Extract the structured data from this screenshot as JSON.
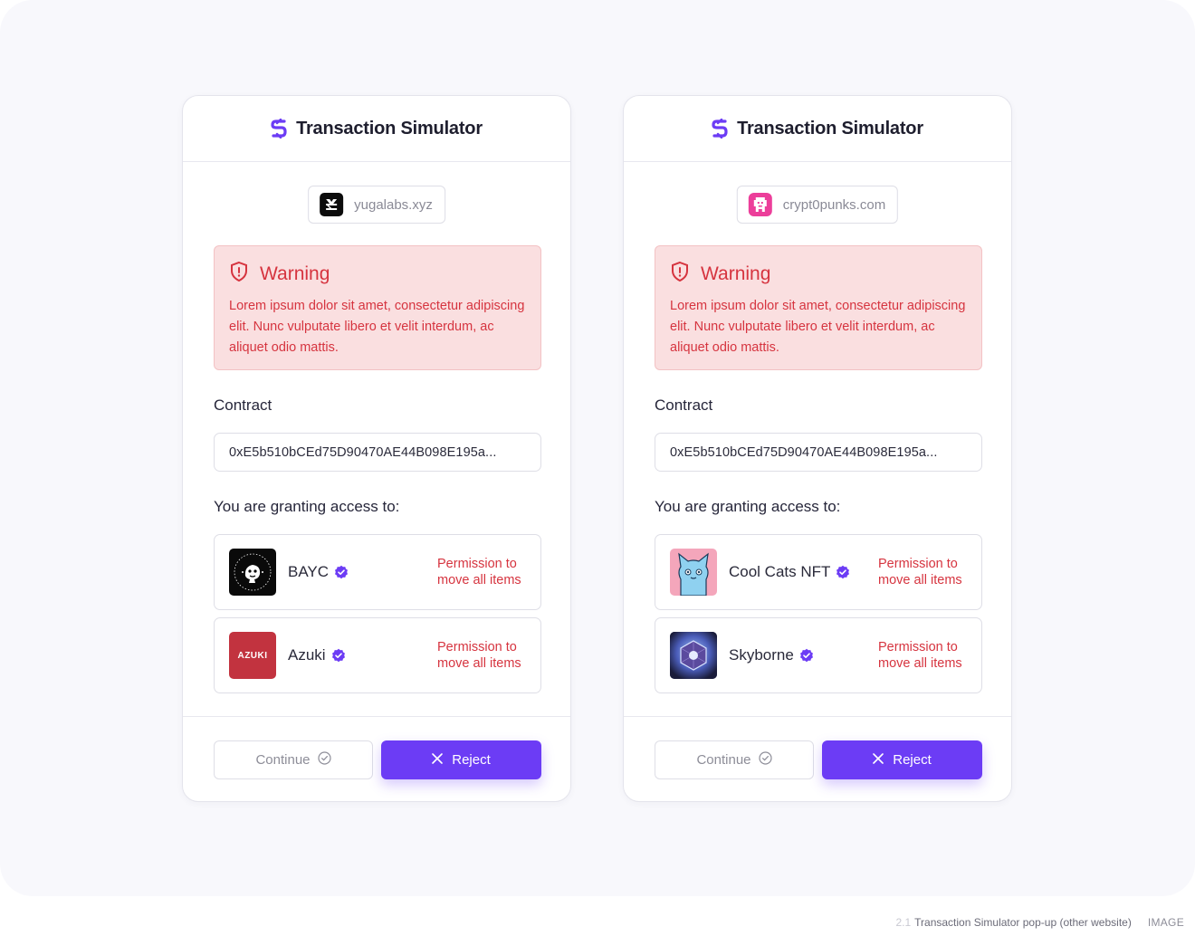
{
  "caption": {
    "index": "2.1",
    "text": "Transaction Simulator pop-up (other website)",
    "kind": "IMAGE"
  },
  "colors": {
    "accent": "#6c3cf5",
    "danger": "#d6343f",
    "warning_bg": "#fadfe0"
  },
  "cards": [
    {
      "title": "Transaction Simulator",
      "site": {
        "name": "yugalabs.xyz",
        "icon": "yuga-labs-logo"
      },
      "warning": {
        "title": "Warning",
        "body": "Lorem ipsum dolor sit amet, consectetur adipiscing elit. Nunc vulputate libero et velit interdum, ac aliquet odio mattis."
      },
      "contract_label": "Contract",
      "contract_address": "0xE5b510bCEd75D90470AE44B098E195a...",
      "access_label": "You are granting access to:",
      "grants": [
        {
          "name": "BAYC",
          "thumb": "bayc-logo",
          "verified": true,
          "permission": "Permission to move all items"
        },
        {
          "name": "Azuki",
          "thumb": "azuki-logo",
          "thumb_text": "AZUKI",
          "verified": true,
          "permission": "Permission to move all items"
        }
      ],
      "continue_label": "Continue",
      "reject_label": "Reject"
    },
    {
      "title": "Transaction Simulator",
      "site": {
        "name": "crypt0punks.com",
        "icon": "cryptopunks-logo"
      },
      "warning": {
        "title": "Warning",
        "body": "Lorem ipsum dolor sit amet, consectetur adipiscing elit. Nunc vulputate libero et velit interdum, ac aliquet odio mattis."
      },
      "contract_label": "Contract",
      "contract_address": "0xE5b510bCEd75D90470AE44B098E195a...",
      "access_label": "You are granting access to:",
      "grants": [
        {
          "name": "Cool Cats NFT",
          "thumb": "cool-cats-logo",
          "verified": true,
          "permission": "Permission to move all items"
        },
        {
          "name": "Skyborne",
          "thumb": "skyborne-logo",
          "verified": true,
          "permission": "Permission to move all items"
        }
      ],
      "continue_label": "Continue",
      "reject_label": "Reject"
    }
  ]
}
